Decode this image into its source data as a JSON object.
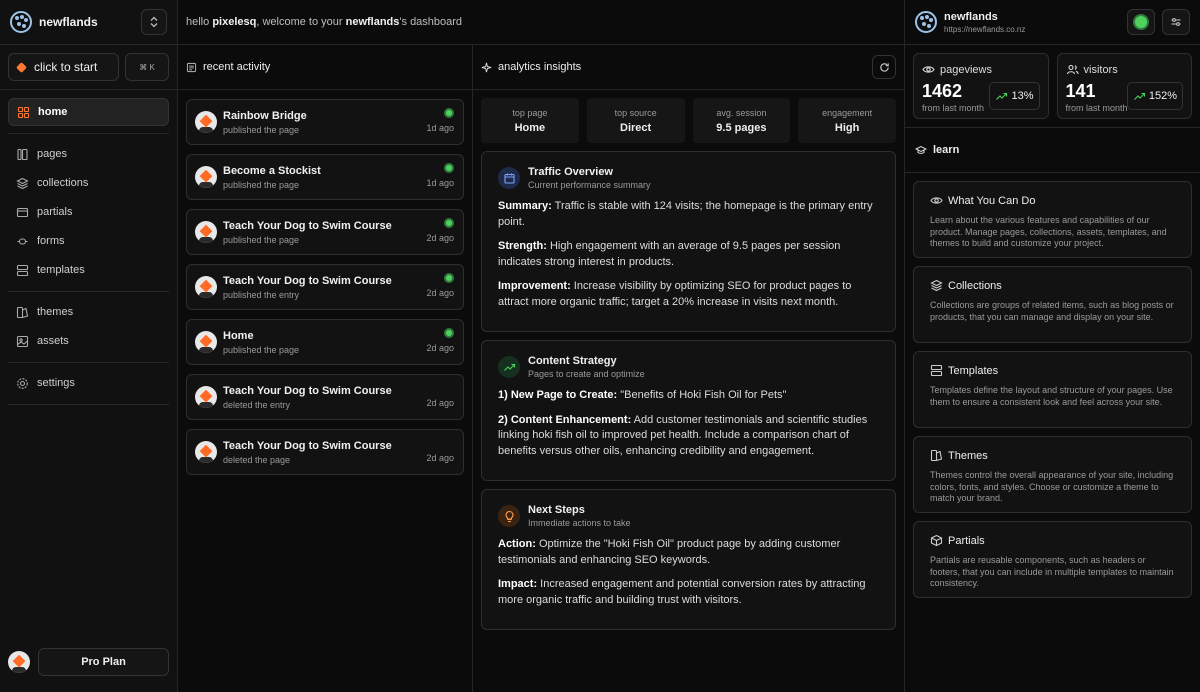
{
  "sidebar": {
    "brand": "newflands",
    "start_label": "click to start",
    "shortcut": "⌘ K",
    "nav": [
      [
        {
          "label": "home",
          "icon": "grid-icon",
          "active": true
        }
      ],
      [
        {
          "label": "pages",
          "icon": "pages-icon"
        },
        {
          "label": "collections",
          "icon": "layers-icon"
        },
        {
          "label": "partials",
          "icon": "partials-icon"
        },
        {
          "label": "forms",
          "icon": "forms-icon"
        },
        {
          "label": "templates",
          "icon": "templates-icon"
        }
      ],
      [
        {
          "label": "themes",
          "icon": "themes-icon"
        },
        {
          "label": "assets",
          "icon": "assets-icon"
        }
      ],
      [
        {
          "label": "settings",
          "icon": "gear-icon"
        }
      ]
    ],
    "plan_label": "Pro Plan"
  },
  "header": {
    "hello": "hello",
    "user": "pixelesq",
    "welcome": ", welcome to your",
    "site": "newflands",
    "suffix": "'s dashboard"
  },
  "activity": {
    "title": "recent activity",
    "items": [
      {
        "title": "Rainbow Bridge",
        "sub": "published the page",
        "time": "1d ago",
        "live": true
      },
      {
        "title": "Become a Stockist",
        "sub": "published the page",
        "time": "1d ago",
        "live": true
      },
      {
        "title": "Teach Your Dog to Swim Course",
        "sub": "published the page",
        "time": "2d ago",
        "live": true
      },
      {
        "title": "Teach Your Dog to Swim Course",
        "sub": "published the entry",
        "time": "2d ago",
        "live": true
      },
      {
        "title": "Home",
        "sub": "published the page",
        "time": "2d ago",
        "live": true
      },
      {
        "title": "Teach Your Dog to Swim Course",
        "sub": "deleted the entry",
        "time": "2d ago",
        "live": false
      },
      {
        "title": "Teach Your Dog to Swim Course",
        "sub": "deleted the page",
        "time": "2d ago",
        "live": false
      }
    ]
  },
  "analytics": {
    "title": "analytics insights",
    "stats": [
      {
        "label": "top page",
        "value": "Home"
      },
      {
        "label": "top source",
        "value": "Direct"
      },
      {
        "label": "avg. session",
        "value": "9.5 pages"
      },
      {
        "label": "engagement",
        "value": "High"
      }
    ],
    "cards": [
      {
        "title": "Traffic Overview",
        "subtitle": "Current performance summary",
        "icon": "calendar-icon",
        "tone": "blue",
        "paras": [
          {
            "label": "Summary:",
            "text": " Traffic is stable with 124 visits; the homepage is the primary entry point."
          },
          {
            "label": "Strength:",
            "text": " High engagement with an average of 9.5 pages per session indicates strong interest in products."
          },
          {
            "label": "Improvement:",
            "text": " Increase visibility by optimizing SEO for product pages to attract more organic traffic; target a 20% increase in visits next month."
          }
        ]
      },
      {
        "title": "Content Strategy",
        "subtitle": "Pages to create and optimize",
        "icon": "trending-up-icon",
        "tone": "green",
        "paras": [
          {
            "label": "1) New Page to Create:",
            "text": " \"Benefits of Hoki Fish Oil for Pets\""
          },
          {
            "label": "2) Content Enhancement:",
            "text": " Add customer testimonials and scientific studies linking hoki fish oil to improved pet health. Include a comparison chart of benefits versus other oils, enhancing credibility and engagement."
          }
        ]
      },
      {
        "title": "Next Steps",
        "subtitle": "Immediate actions to take",
        "icon": "lightbulb-icon",
        "tone": "orange",
        "paras": [
          {
            "label": "Action:",
            "text": " Optimize the \"Hoki Fish Oil\" product page by adding customer testimonials and enhancing SEO keywords."
          },
          {
            "label": "Impact:",
            "text": " Increased engagement and potential conversion rates by attracting more organic traffic and building trust with visitors."
          }
        ]
      }
    ]
  },
  "right": {
    "site_name": "newflands",
    "site_url": "https://newflands.co.nz",
    "metrics": [
      {
        "label": "pageviews",
        "icon": "eye-icon",
        "value": "1462",
        "sub": "from last month",
        "change": "13%"
      },
      {
        "label": "visitors",
        "icon": "users-icon",
        "value": "141",
        "sub": "from last month",
        "change": "152%"
      }
    ],
    "learn_title": "learn",
    "learn": [
      {
        "title": "What You Can Do",
        "icon": "eye-icon",
        "desc": "Learn about the various features and capabilities of our product. Manage pages, collections, assets, templates, and themes to build and customize your project."
      },
      {
        "title": "Collections",
        "icon": "layers-icon",
        "desc": "Collections are groups of related items, such as blog posts or products, that you can manage and display on your site."
      },
      {
        "title": "Templates",
        "icon": "templates-icon",
        "desc": "Templates define the layout and structure of your pages. Use them to ensure a consistent look and feel across your site."
      },
      {
        "title": "Themes",
        "icon": "themes-icon",
        "desc": "Themes control the overall appearance of your site, including colors, fonts, and styles. Choose or customize a theme to match your brand."
      },
      {
        "title": "Partials",
        "icon": "box-icon",
        "desc": "Partials are reusable components, such as headers or footers, that you can include in multiple templates to maintain consistency."
      }
    ]
  },
  "colors": {
    "accent": "#ff7a2e",
    "success": "#4fd25d",
    "bg": "#0b0b0b"
  }
}
